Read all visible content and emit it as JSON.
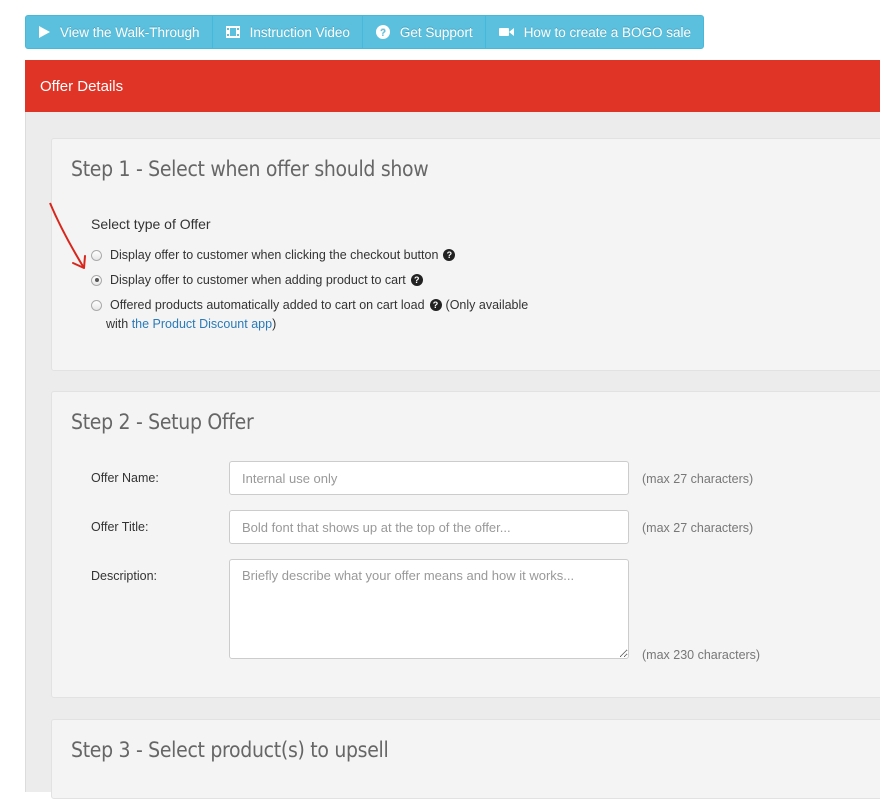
{
  "toolbar": {
    "walkthrough": "View the Walk-Through",
    "video": "Instruction Video",
    "support": "Get Support",
    "bogo": "How to create a BOGO sale"
  },
  "header": {
    "title": "Offer Details"
  },
  "step1": {
    "title": "Step 1 - Select when offer should show",
    "select_label": "Select type of Offer",
    "options": [
      {
        "label": "Display offer to customer when clicking the checkout button",
        "checked": false
      },
      {
        "label": "Display offer to customer when adding product to cart",
        "checked": true
      },
      {
        "label": "Offered products automatically added to cart on cart load",
        "checked": false
      }
    ],
    "option3_note_prefix": "(Only available",
    "option3_note_with": "with ",
    "option3_link": "the Product Discount app",
    "option3_note_suffix": ")"
  },
  "step2": {
    "title": "Step 2 - Setup Offer",
    "fields": [
      {
        "label": "Offer Name:",
        "placeholder": "Internal use only",
        "hint": "(max 27 characters)"
      },
      {
        "label": "Offer Title:",
        "placeholder": "Bold font that shows up at the top of the offer...",
        "hint": "(max 27 characters)"
      },
      {
        "label": "Description:",
        "placeholder": "Briefly describe what your offer means and how it works...",
        "hint": "(max 230 characters)"
      }
    ]
  },
  "step3": {
    "title": "Step 3 - Select product(s) to upsell"
  },
  "colors": {
    "accent": "#5bc0de",
    "header": "#e03427",
    "link": "#2a7ab8",
    "arrow": "#d9261c"
  }
}
